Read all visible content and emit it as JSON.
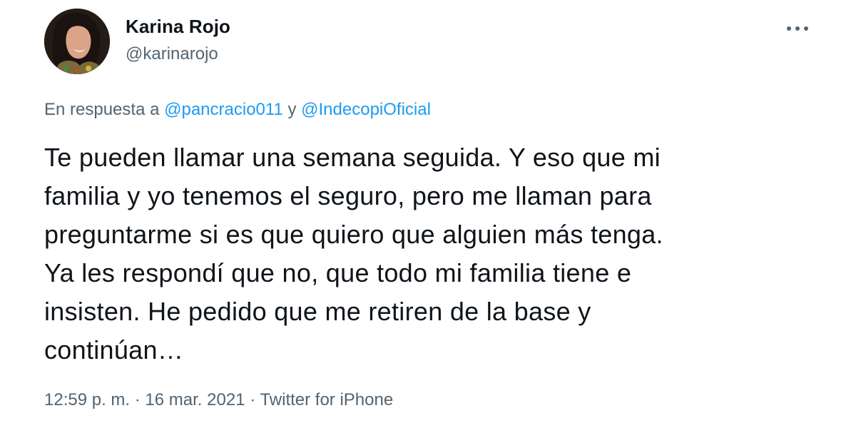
{
  "author": {
    "display_name": "Karina Rojo",
    "handle": "@karinarojo"
  },
  "more_icon": "more-horizontal-icon",
  "reply_context": {
    "prefix": "En respuesta a",
    "mention_1": "@pancracio011",
    "conjunction": "y",
    "mention_2": "@IndecopiOficial"
  },
  "tweet": {
    "text": "Te pueden llamar una semana seguida. Y eso que mi\nfamilia y yo tenemos el seguro, pero me llaman para\npreguntarme si es que quiero que alguien más tenga.\nYa les respondí que no, que todo mi familia tiene e\ninsisten. He pedido que me retiren de la base y\ncontinúan…"
  },
  "meta": {
    "time": "12:59 p. m.",
    "separator": "·",
    "date": "16 mar. 2021",
    "source": "Twitter for iPhone"
  },
  "colors": {
    "text_primary": "#0f1419",
    "text_secondary": "#536471",
    "link": "#1d9bf0"
  }
}
